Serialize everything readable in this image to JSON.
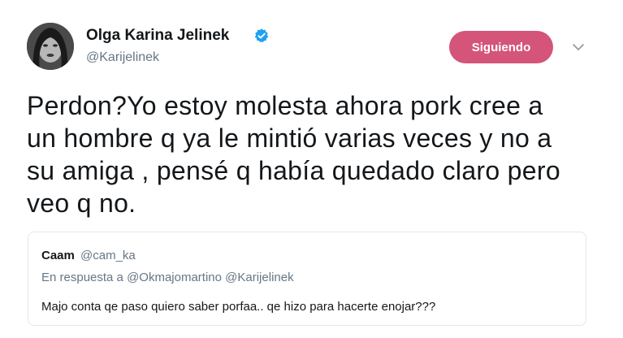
{
  "author": {
    "display_name": "Olga Karina Jelinek",
    "handle": "@Karijelinek",
    "verified_icon": "verified-badge-icon",
    "avatar_icon": "profile-photo"
  },
  "follow_button": {
    "label": "Siguiendo",
    "color": "#d4547a"
  },
  "menu_icon": "chevron-down-icon",
  "tweet": {
    "lines": [
      "Perdon?Yo estoy molesta ahora pork cree a",
      "un hombre q ya le mintió varias veces y no a",
      "su amiga , pensé q había quedado claro pero",
      "veo q no."
    ]
  },
  "quoted_tweet": {
    "display_name": "Caam",
    "handle": "@cam_ka",
    "reply_to": "En respuesta a @Okmajomartino @Karijelinek",
    "text": "Majo conta qe paso quiero saber porfaa.. qe hizo para hacerte enojar???"
  },
  "colors": {
    "text": "#14171a",
    "secondary": "#657786",
    "verified": "#1da1f2",
    "border": "#e1e8ed"
  }
}
